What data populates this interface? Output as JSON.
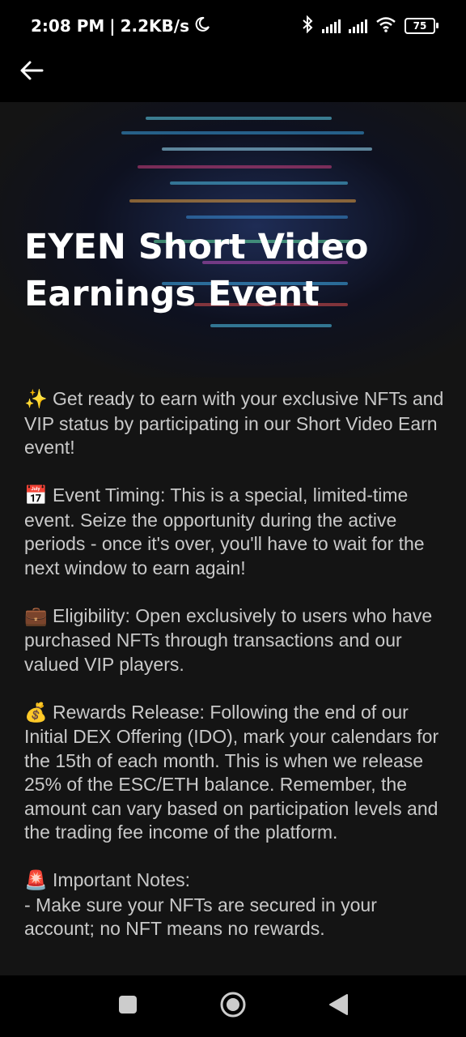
{
  "status_bar": {
    "time": "2:08 PM",
    "separator": "|",
    "speed": "2.2KB/s",
    "battery": "75"
  },
  "app_bar": {
    "back_icon": "arrow-left-icon"
  },
  "hero": {
    "title": "EYEN Short Video Earnings Event"
  },
  "sections": [
    {
      "emoji": "✨",
      "lines": [
        "Get ready to earn with your exclusive NFTs and VIP status by participating in our Short Video Earn event!"
      ]
    },
    {
      "emoji": "📅",
      "lines": [
        "Event Timing: This is a special, limited-time event. Seize the opportunity during the active periods - once it's over, you'll have to wait for the next window to earn again!"
      ]
    },
    {
      "emoji": "💼",
      "lines": [
        "Eligibility: Open exclusively to users who have purchased NFTs through transactions and our valued VIP players."
      ]
    },
    {
      "emoji": "💰",
      "lines": [
        "Rewards Release: Following the end of our Initial DEX Offering (IDO), mark your calendars for the 15th of each month. This is when we release 25% of the ESC/ETH balance. Remember, the amount can vary based on participation levels and the trading fee income of the platform."
      ]
    },
    {
      "emoji": "🚨",
      "lines": [
        "Important Notes:",
        "- Make sure your NFTs are secured in your account; no NFT means no rewards."
      ]
    }
  ],
  "nav_bar": {
    "icons": [
      "recents-square-icon",
      "home-circle-icon",
      "back-triangle-icon"
    ]
  }
}
